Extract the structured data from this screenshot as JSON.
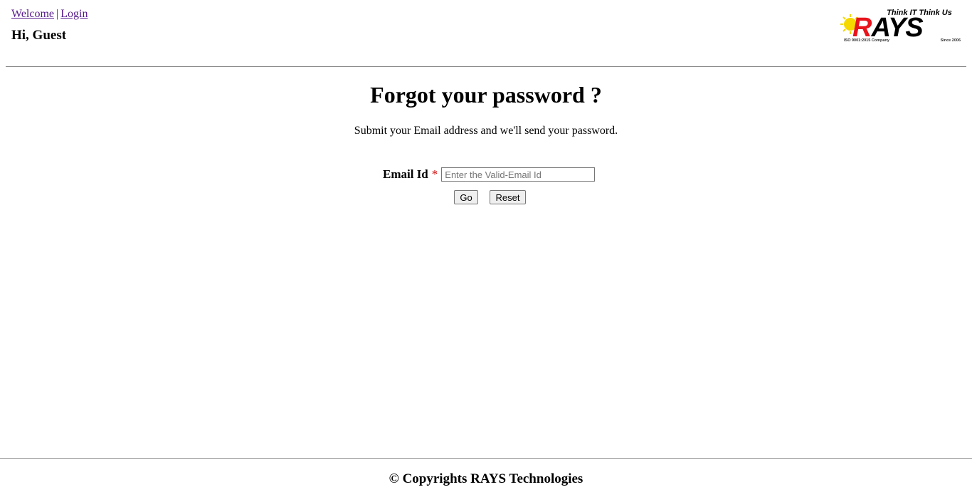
{
  "nav": {
    "welcome": "Welcome",
    "separator": "|",
    "login": "Login"
  },
  "greeting": "Hi, Guest",
  "logo": {
    "tagline": "Think IT Think Us",
    "brand": "RAYS",
    "iso": "ISO 9001:2015 Company",
    "since": "Since 2006",
    "colors": {
      "sun": "#f5d800",
      "r": "#e8141c",
      "text": "#000000"
    }
  },
  "form": {
    "title": "Forgot your password ?",
    "subtitle": "Submit your Email address and we'll send your password.",
    "email_label": "Email Id",
    "required_mark": "*",
    "email_value": "",
    "email_placeholder": "Enter the Valid-Email Id",
    "go_label": "Go",
    "reset_label": "Reset"
  },
  "footer": {
    "text": "© Copyrights RAYS Technologies"
  }
}
